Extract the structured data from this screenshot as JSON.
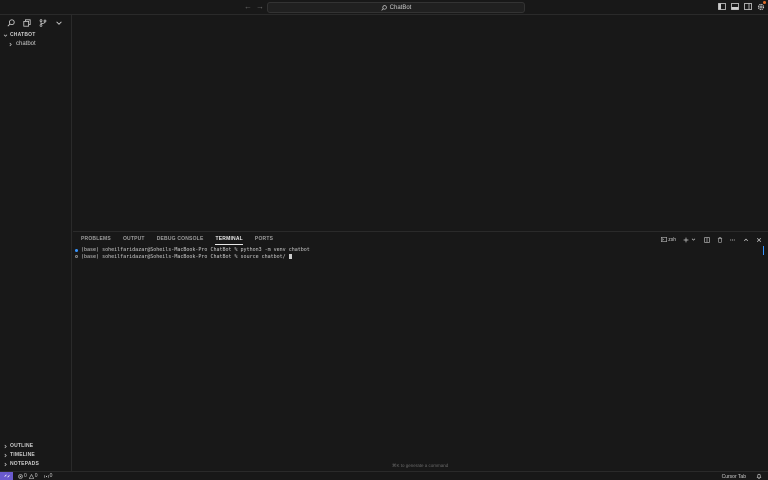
{
  "titlebar": {
    "search_label": "ChatBot"
  },
  "sidebar": {
    "section_title": "CHATBOT",
    "tree_item": "chatbot",
    "bottom_sections": [
      "OUTLINE",
      "TIMELINE",
      "NOTEPADS"
    ]
  },
  "panel": {
    "tabs": [
      "PROBLEMS",
      "OUTPUT",
      "DEBUG CONSOLE",
      "TERMINAL",
      "PORTS"
    ],
    "active_tab": "TERMINAL",
    "shell_label": "zsh",
    "terminal_lines": [
      "(base) soheilfaridazar@Soheils-MacBook-Pro ChatBot % python3 -m venv chatbot",
      "(base) soheilfaridazar@Soheils-MacBook-Pro ChatBot % source chatbot/"
    ],
    "hint": "⌘K to generate a command"
  },
  "statusbar": {
    "errors": "0",
    "warnings": "0",
    "ports": "0",
    "cursor_tab": "Cursor Tab"
  },
  "colors": {
    "accent": "#3794ff",
    "remote": "#6a5acd",
    "badge": "#e06c2b"
  }
}
